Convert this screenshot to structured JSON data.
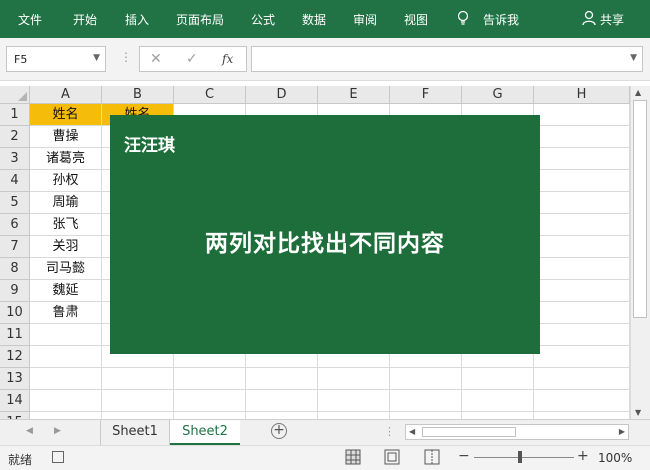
{
  "ribbon": {
    "tabs": [
      {
        "label": "文件"
      },
      {
        "label": "开始"
      },
      {
        "label": "插入"
      },
      {
        "label": "页面布局"
      },
      {
        "label": "公式"
      },
      {
        "label": "数据"
      },
      {
        "label": "审阅"
      },
      {
        "label": "视图"
      }
    ],
    "tell_me": "告诉我",
    "share": "共享",
    "color": "#217346"
  },
  "formula_bar": {
    "name_box": "F5",
    "cancel_icon": "✕",
    "enter_icon": "✓",
    "fx_label": "fx",
    "formula_value": ""
  },
  "grid": {
    "columns": [
      "A",
      "B",
      "C",
      "D",
      "E",
      "F",
      "G",
      "H"
    ],
    "rows": [
      "1",
      "2",
      "3",
      "4",
      "5",
      "6",
      "7",
      "8",
      "9",
      "10",
      "11",
      "12",
      "13",
      "14",
      "15"
    ],
    "col_a": [
      "姓名",
      "曹操",
      "诸葛亮",
      "孙权",
      "周瑜",
      "张飞",
      "关羽",
      "司马懿",
      "魏延",
      "鲁肃"
    ],
    "col_b_header": "姓名",
    "header_fill": "#f5bd09"
  },
  "overlay": {
    "author": "汪汪琪",
    "title": "两列对比找出不同内容",
    "color": "#1e6e3c"
  },
  "sheets": {
    "tabs": [
      {
        "label": "Sheet1",
        "active": false
      },
      {
        "label": "Sheet2",
        "active": true
      }
    ]
  },
  "status": {
    "ready": "就绪",
    "zoom": "100%"
  }
}
